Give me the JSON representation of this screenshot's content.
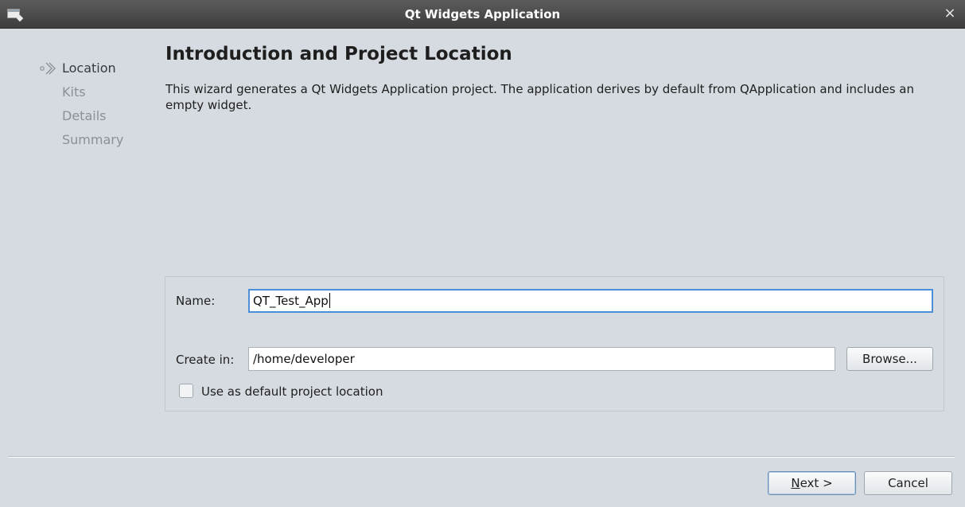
{
  "window": {
    "title": "Qt Widgets Application",
    "close_glyph": "×",
    "app_icon": "window-icon"
  },
  "steps": [
    {
      "label": "Location",
      "active": true
    },
    {
      "label": "Kits",
      "active": false
    },
    {
      "label": "Details",
      "active": false
    },
    {
      "label": "Summary",
      "active": false
    }
  ],
  "page": {
    "heading": "Introduction and Project Location",
    "intro": "This wizard generates a Qt Widgets Application project. The application derives by default from QApplication and includes an empty widget."
  },
  "form": {
    "name_label": "Name:",
    "name_value": "QT_Test_App",
    "create_in_label": "Create in:",
    "create_in_value": "/home/developer",
    "browse_label": "Browse...",
    "default_location_label": "Use as default project location",
    "default_location_checked": false
  },
  "buttons": {
    "next_mnemonic": "N",
    "next_rest": "ext >",
    "cancel_label": "Cancel"
  },
  "colors": {
    "focus_border": "#4a8fd8",
    "titlebar": "#4a4a4a",
    "background": "#d6dbe1"
  }
}
